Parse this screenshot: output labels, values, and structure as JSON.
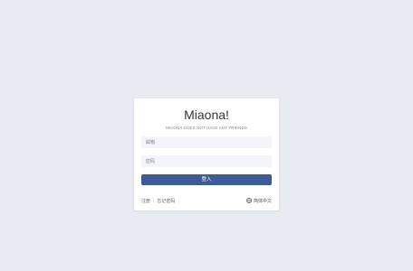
{
  "app": {
    "title": "Miaona!",
    "subtitle": "MIAONA DOES NOT HAVE ANY FRIENDS"
  },
  "form": {
    "email_placeholder": "邮箱",
    "password_placeholder": "密码",
    "login_label": "登入"
  },
  "footer": {
    "register_label": "注册",
    "forgot_label": "忘记密码",
    "language_label": "简体中文",
    "language_icon": "globe-icon"
  },
  "colors": {
    "background": "#e8ebf1",
    "accent": "#3e5a99"
  }
}
